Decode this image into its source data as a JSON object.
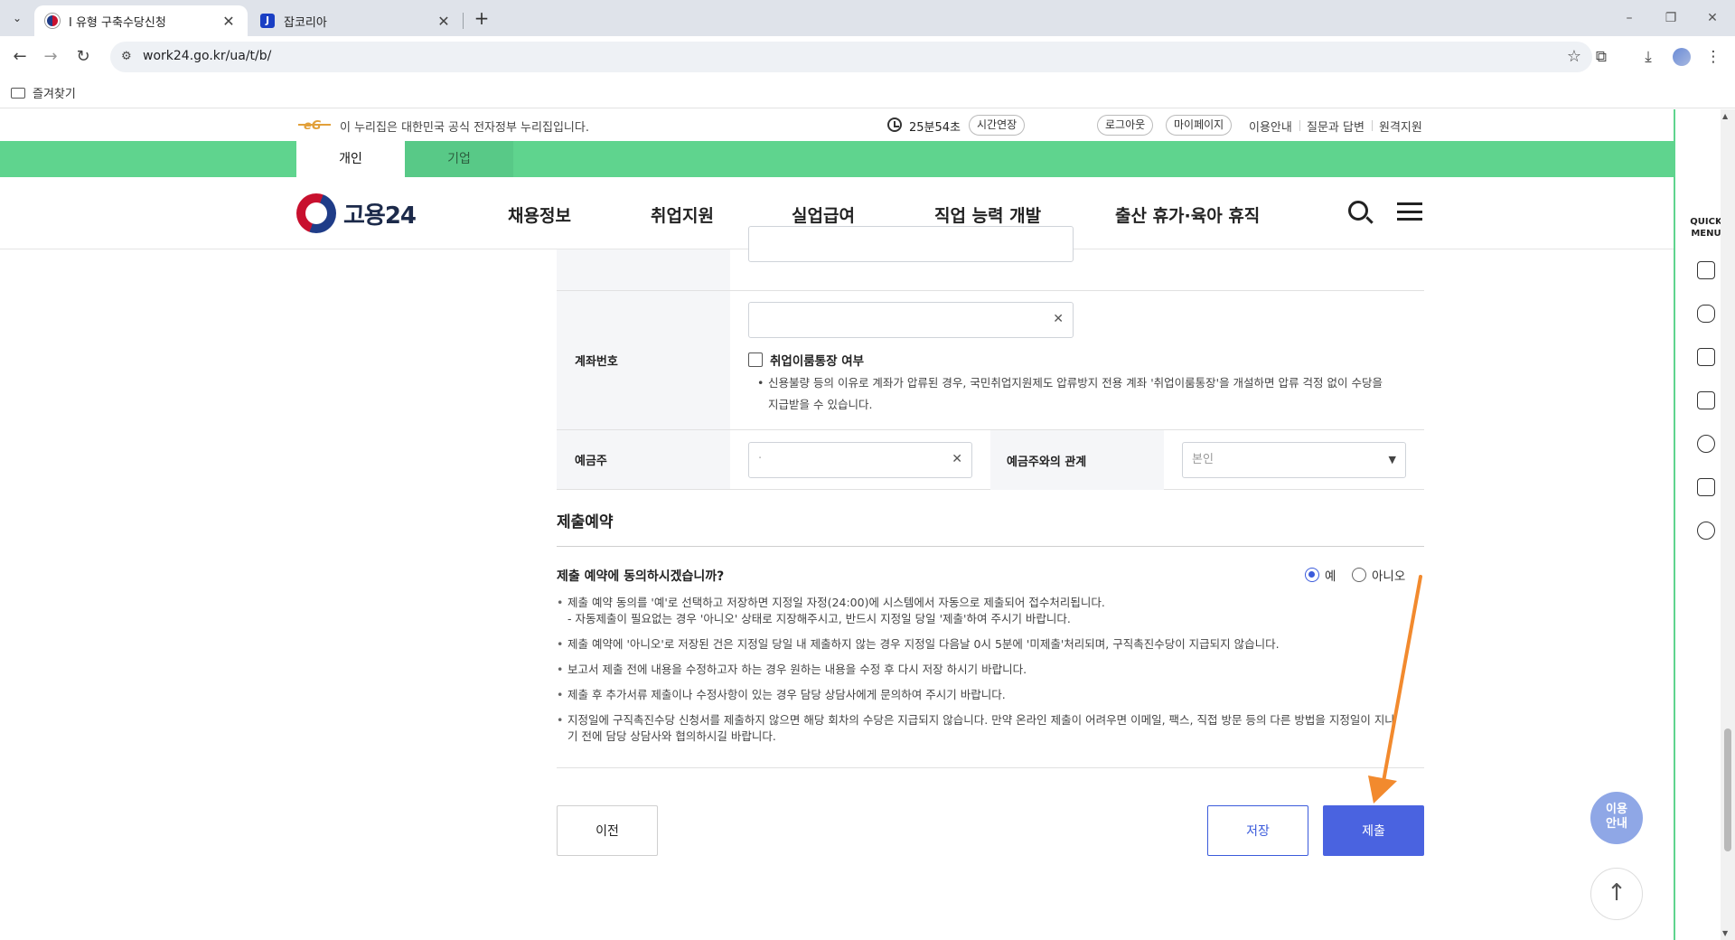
{
  "browser": {
    "tabs": [
      {
        "title": "I 유형 구축수당신청",
        "active": true
      },
      {
        "title": "잡코리아",
        "active": false
      }
    ],
    "url": "work24.go.kr/ua/t/b/",
    "bookmark_folder": "즐겨찾기",
    "window_controls": [
      "–",
      "❐",
      "✕"
    ]
  },
  "gov_bar": {
    "notice": "이 누리집은 대한민국 공식 전자정부 누리집입니다.",
    "session_timer": "25분54초",
    "extend_label": "시간연장",
    "logout_label": "로그아웃",
    "mypage_label": "마이페이지",
    "links": [
      "이용안내",
      "질문과 답변",
      "원격지원"
    ]
  },
  "segment_tabs": [
    "개인",
    "기업"
  ],
  "brand": {
    "name": "고용24"
  },
  "main_menu": [
    "채용정보",
    "취업지원",
    "실업급여",
    "직업 능력 개발",
    "출산 휴가·육아 휴직"
  ],
  "form": {
    "account_label": "계좌번호",
    "job_account_checkbox": "취업이룸통장 여부",
    "job_account_desc_1": "신용불량 등의 이유로 계좌가 압류된 경우, 국민취업지원제도 압류방지 전용 계좌 '취업이룸통장'을 개설하면 압류 걱정 없이 수당을",
    "job_account_desc_2": "지급받을 수 있습니다.",
    "depositor_label": "예금주",
    "depositor_value": "·",
    "relation_label": "예금주와의 관계",
    "relation_value": "본인",
    "clear_glyph": "✕"
  },
  "reservation": {
    "section_title": "제출예약",
    "question": "제출 예약에 동의하시겠습니까?",
    "options": [
      "예",
      "아니오"
    ],
    "selected": "예",
    "notes": [
      {
        "text": "제출 예약 동의를 '예'로 선택하고 저장하면 지정일 자정(24:00)에 시스템에서 자동으로 제출되어 접수처리됩니다.",
        "sub": "- 자동제출이 필요없는 경우 '아니오' 상태로 지장해주시고, 반드시 지정일 당일 '제출'하여 주시기 바랍니다."
      },
      {
        "text": "제출 예약에 '아니오'로 저장된 건은 지정일 당일 내 제출하지 않는 경우 지정일 다음날 0시 5분에 '미제출'처리되며, 구직촉진수당이 지급되지 않습니다.",
        "sub": ""
      },
      {
        "text": "보고서 제출 전에 내용을 수정하고자 하는 경우 원하는 내용을 수정 후 다시 저장 하시기 바랍니다.",
        "sub": ""
      },
      {
        "text": "제출 후 추가서류 제출이나 수정사항이 있는 경우 담당 상담사에게 문의하여 주시기 바랍니다.",
        "sub": ""
      },
      {
        "text": "지정일에 구직촉진수당 신청서를 제출하지 않으면 해당 회차의 수당은 지급되지 않습니다. 만약 온라인 제출이 어려우면 이메일, 팩스, 직접 방문 등의 다른 방법을 지정일이 지나",
        "sub": "기 전에 담당 상담사와 협의하시길 바랍니다."
      }
    ]
  },
  "buttons": {
    "prev": "이전",
    "save": "저장",
    "submit": "제출"
  },
  "quick_menu": {
    "title_line1": "QUICK",
    "title_line2": "MENU"
  },
  "floating": {
    "guide_line1": "이용",
    "guide_line2": "안내",
    "top": "↑"
  },
  "colors": {
    "accent_green": "#5fd48e",
    "primary_blue": "#4a63e0",
    "annotation_orange": "#f28a2e"
  }
}
